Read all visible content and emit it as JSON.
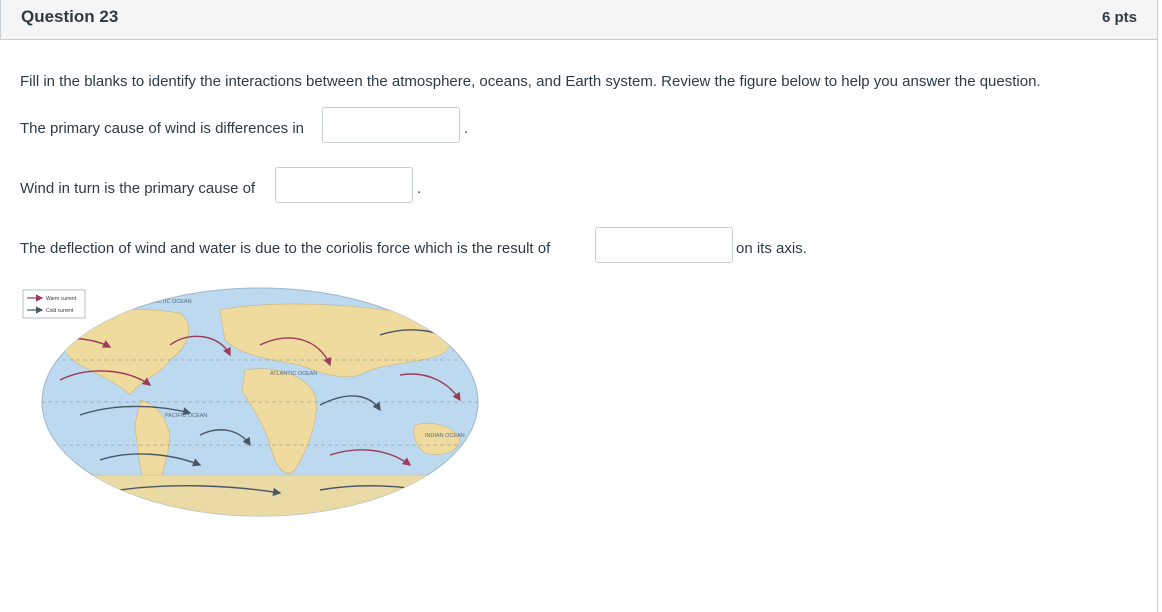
{
  "question": {
    "title": "Question 23",
    "points": "6 pts",
    "instructions": "Fill in the blanks to identify the interactions between the atmosphere, oceans, and Earth system. Review the figure below to help you answer the question.",
    "sentence1": {
      "before": "The primary cause of wind is differences in",
      "value": "",
      "after": "."
    },
    "sentence2": {
      "before": "Wind in turn is the primary cause of",
      "value": "",
      "after": "."
    },
    "sentence3": {
      "before": "The deflection of wind and water is due to the coriolis force which is the result of",
      "value": "",
      "after": "on its axis."
    }
  },
  "figure": {
    "legend": [
      "Warm current",
      "Cold current"
    ],
    "ocean_labels": [
      "ARCTIC OCEAN",
      "ATLANTIC OCEAN",
      "PACIFIC OCEAN",
      "INDIAN OCEAN"
    ],
    "colors": {
      "ocean": "#bcd9ef",
      "land": "#efdb9e",
      "warm": "#9a3b5a",
      "cold": "#4a5563"
    }
  }
}
